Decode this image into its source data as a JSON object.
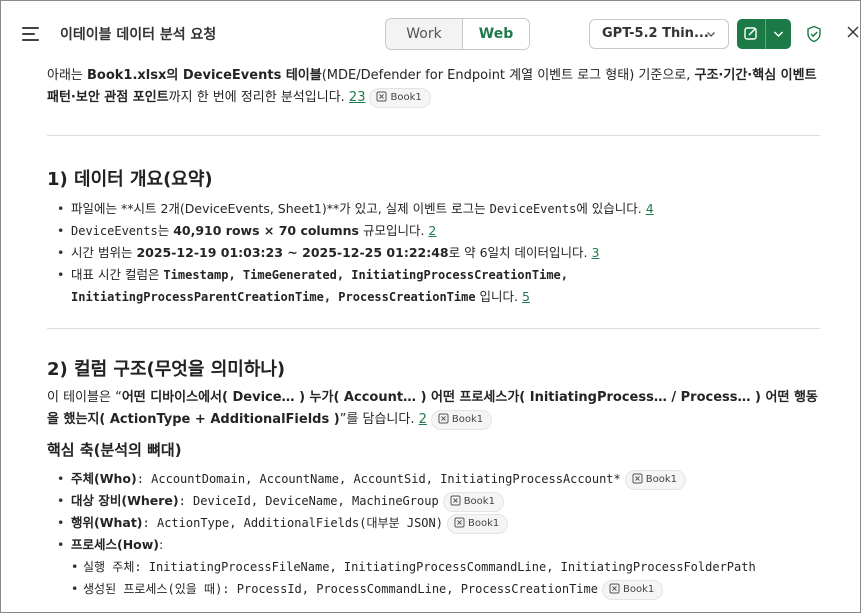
{
  "header": {
    "title": "이테이블 데이터 분석 요청",
    "mode_work": "Work",
    "mode_web": "Web",
    "model": "GPT-5.2 Thin..."
  },
  "intro": {
    "t1": "아래는 ",
    "b1": "Book1.xlsx의 DeviceEvents 테이블",
    "t2": "(MDE/Defender for Endpoint 계열 이벤트 로그 형태) 기준으로, ",
    "b2": "구조·기간·핵심 이벤트 패턴·보안 관점 포인트",
    "t3": "까지 한 번에 정리한 분석입니다. ",
    "ref": "23",
    "chip": "Book1"
  },
  "sec1": {
    "heading": "1) 데이터 개요(요약)",
    "items": [
      {
        "t1": "파일에는 **시트 2개(DeviceEvents, Sheet1)**가 있고, 실제 이벤트 로그는 ",
        "m1": "DeviceEvents",
        "t2": "에 있습니다. ",
        "ref": "4"
      },
      {
        "m1": "DeviceEvents",
        "t1": "는 ",
        "b1": "40,910 rows × 70 columns",
        "t2": " 규모입니다. ",
        "ref": "2"
      },
      {
        "t1": "시간 범위는 ",
        "b1": "2025-12-19 01:03:23 ~ 2025-12-25 01:22:48",
        "t2": "로 약 6일치 데이터입니다. ",
        "ref": "3"
      },
      {
        "t1": "대표 시간 컬럼은 ",
        "b1": "Timestamp, TimeGenerated, InitiatingProcessCreationTime,",
        "b2": "InitiatingProcessParentCreationTime, ProcessCreationTime",
        "t2": " 입니다. ",
        "ref": "5"
      }
    ]
  },
  "sec2": {
    "heading": "2) 컬럼 구조(무엇을 의미하나)",
    "p_t1": "이 테이블은 “",
    "p_b1": "어떤 디바이스에서( Device… ) 누가( Account… ) 어떤 프로세스가( InitiatingProcess… / Process… ) 어떤 행동을 했는지( ActionType + AdditionalFields )",
    "p_t2": "”를 담습니다. ",
    "p_ref": "2",
    "p_chip": "Book1",
    "sub_heading": "핵심 축(분석의 뼈대)",
    "items": [
      {
        "b": "주체(Who)",
        "t": ": AccountDomain, AccountName, AccountSid, InitiatingProcessAccount*",
        "chip": "Book1"
      },
      {
        "b": "대상 장비(Where)",
        "t": ": DeviceId, DeviceName, MachineGroup",
        "chip": "Book1"
      },
      {
        "b": "행위(What)",
        "t": ": ActionType, AdditionalFields(대부분 JSON)",
        "chip": "Book1"
      },
      {
        "b": "프로세스(How)",
        "t": ":"
      }
    ],
    "sub_items": [
      {
        "t": "실행 주체: InitiatingProcessFileName, InitiatingProcessCommandLine, InitiatingProcessFolderPath"
      },
      {
        "t": "생성된 프로세스(있을 때): ProcessId, ProcessCommandLine, ProcessCreationTime",
        "chip": "Book1"
      }
    ]
  }
}
